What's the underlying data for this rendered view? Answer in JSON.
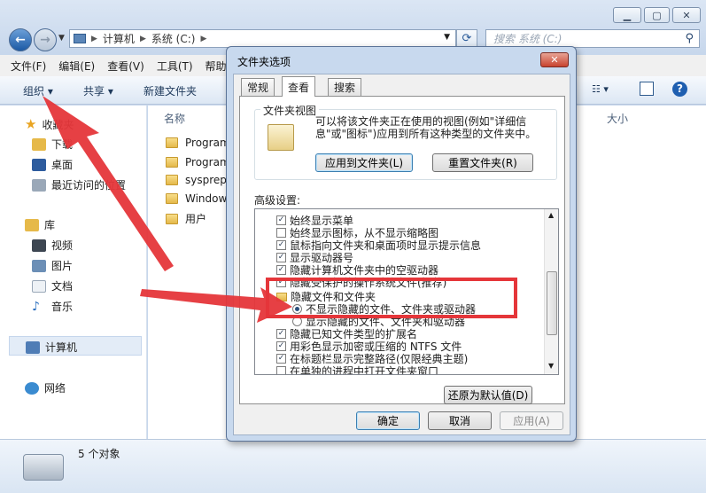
{
  "explorer": {
    "address": [
      "计算机",
      "系统 (C:)"
    ],
    "search_placeholder": "搜索 系统 (C:)",
    "menu": [
      "文件(F)",
      "编辑(E)",
      "查看(V)",
      "工具(T)",
      "帮助"
    ],
    "toolbar": {
      "organize": "组织 ▾",
      "share": "共享 ▾",
      "new_folder": "新建文件夹"
    },
    "nav": {
      "favorites": "收藏夹",
      "downloads": "下载",
      "desktop": "桌面",
      "recent": "最近访问的位置",
      "libraries": "库",
      "videos": "视频",
      "pictures": "图片",
      "documents": "文档",
      "music": "音乐",
      "computer": "计算机",
      "network": "网络"
    },
    "columns": {
      "name": "名称",
      "size": "大小"
    },
    "files": [
      "Program",
      "Program",
      "sysprep",
      "Windows",
      "用户"
    ],
    "status": "5 个对象"
  },
  "dialog": {
    "title": "文件夹选项",
    "close": "✕",
    "tabs": [
      "常规",
      "查看",
      "搜索"
    ],
    "folder_views": {
      "legend": "文件夹视图",
      "description": "可以将该文件夹正在使用的视图(例如\"详细信息\"或\"图标\")应用到所有这种类型的文件夹中。",
      "apply_button": "应用到文件夹(L)",
      "reset_button": "重置文件夹(R)"
    },
    "advanced_label": "高级设置:",
    "settings": [
      {
        "kind": "checkbox",
        "checked": true,
        "label": "始终显示菜单"
      },
      {
        "kind": "checkbox",
        "checked": false,
        "label": "始终显示图标，从不显示缩略图"
      },
      {
        "kind": "checkbox",
        "checked": true,
        "label": "鼠标指向文件夹和桌面项时显示提示信息"
      },
      {
        "kind": "checkbox",
        "checked": true,
        "label": "显示驱动器号"
      },
      {
        "kind": "checkbox",
        "checked": true,
        "label": "隐藏计算机文件夹中的空驱动器"
      },
      {
        "kind": "checkbox",
        "checked": true,
        "label": "隐藏受保护的操作系统文件(推荐)"
      },
      {
        "kind": "folder",
        "label": "隐藏文件和文件夹"
      },
      {
        "kind": "radio",
        "checked": true,
        "label": "不显示隐藏的文件、文件夹或驱动器"
      },
      {
        "kind": "radio",
        "checked": false,
        "label": "显示隐藏的文件、文件夹和驱动器"
      },
      {
        "kind": "checkbox",
        "checked": true,
        "label": "隐藏已知文件类型的扩展名"
      },
      {
        "kind": "checkbox",
        "checked": true,
        "label": "用彩色显示加密或压缩的 NTFS 文件"
      },
      {
        "kind": "checkbox",
        "checked": true,
        "label": "在标题栏显示完整路径(仅限经典主题)"
      },
      {
        "kind": "checkbox",
        "checked": false,
        "label": "在单独的进程中打开文件夹窗口"
      }
    ],
    "restore_button": "还原为默认值(D)",
    "ok_button": "确定",
    "cancel_button": "取消",
    "apply_button": "应用(A)"
  },
  "colors": {
    "annotation_red": "#e5363a",
    "title_bar": "#c8d9ee"
  }
}
